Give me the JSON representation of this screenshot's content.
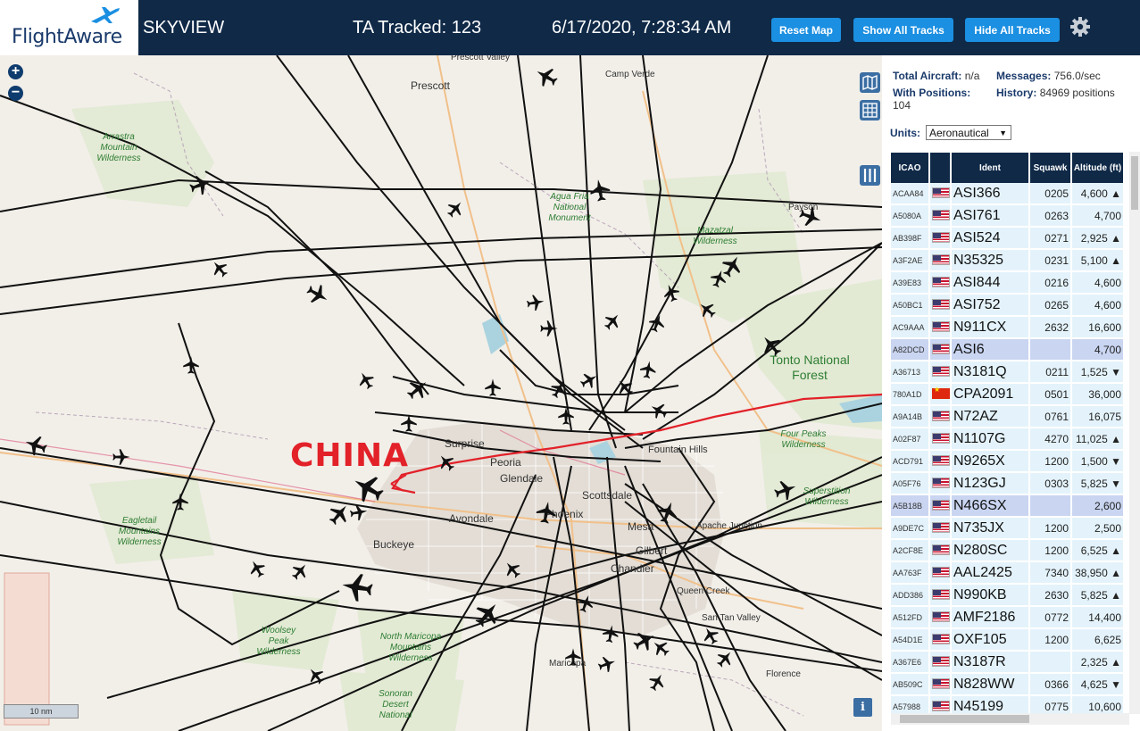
{
  "header": {
    "logo_text": "FlightAware",
    "app_title": "SKYVIEW",
    "tracked": "TA Tracked: 123",
    "datetime": "6/17/2020, 7:28:34 AM",
    "buttons": {
      "reset": "Reset Map",
      "show": "Show All Tracks",
      "hide": "Hide All Tracks"
    },
    "settings_icon": "gear-icon"
  },
  "map": {
    "zoom_in": "+",
    "zoom_out": "−",
    "scale": "10 nm",
    "info": "i",
    "annotation": "CHINA",
    "cities": [
      "Prescott Valley",
      "Prescott",
      "Camp Verde",
      "Payson",
      "Surprise",
      "Peoria",
      "Glendale",
      "Scottsdale",
      "Fountain Hills",
      "Phoenix",
      "Avondale",
      "Buckeye",
      "Mesa",
      "Apache Junction",
      "Gilbert",
      "Chandler",
      "Queen Creek",
      "San Tan Valley",
      "Maricopa",
      "Florence"
    ],
    "wilderness": [
      "Arrastra Mountain Wilderness",
      "Agua Fria National Monument",
      "Mazatzal Wilderness",
      "Four Peaks Wilderness",
      "Superstition Wilderness",
      "Eagletail Mountains Wilderness",
      "Woolsey Peak Wilderness",
      "North Maricopa Mountains Wilderness",
      "Sonoran Desert National"
    ],
    "forest": "Tonto National Forest"
  },
  "stats": {
    "total_label": "Total Aircraft:",
    "total_value": "n/a",
    "messages_label": "Messages:",
    "messages_value": "756.0/sec",
    "positions_label": "With Positions:",
    "positions_value": "104",
    "history_label": "History:",
    "history_value": "84969 positions"
  },
  "units": {
    "label": "Units:",
    "value": "Aeronautical"
  },
  "table": {
    "columns": [
      "ICAO",
      "",
      "Ident",
      "Squawk",
      "Altitude (ft)"
    ],
    "rows": [
      {
        "icao": "ACAA84",
        "flag": "us",
        "ident": "ASI366",
        "squawk": "0205",
        "alt": "4,600 ▲"
      },
      {
        "icao": "A5080A",
        "flag": "us",
        "ident": "ASI761",
        "squawk": "0263",
        "alt": "4,700"
      },
      {
        "icao": "AB398F",
        "flag": "us",
        "ident": "ASI524",
        "squawk": "0271",
        "alt": "2,925 ▲"
      },
      {
        "icao": "A3F2AE",
        "flag": "us",
        "ident": "N35325",
        "squawk": "0231",
        "alt": "5,100 ▲"
      },
      {
        "icao": "A39E83",
        "flag": "us",
        "ident": "ASI844",
        "squawk": "0216",
        "alt": "4,600"
      },
      {
        "icao": "A50BC1",
        "flag": "us",
        "ident": "ASI752",
        "squawk": "0265",
        "alt": "4,600"
      },
      {
        "icao": "AC9AAA",
        "flag": "us",
        "ident": "N911CX",
        "squawk": "2632",
        "alt": "16,600"
      },
      {
        "icao": "A82DCD",
        "flag": "us",
        "ident": "ASI6",
        "squawk": "",
        "alt": "4,700",
        "selected": true
      },
      {
        "icao": "A36713",
        "flag": "us",
        "ident": "N3181Q",
        "squawk": "0211",
        "alt": "1,525 ▼"
      },
      {
        "icao": "780A1D",
        "flag": "cn",
        "ident": "CPA2091",
        "squawk": "0501",
        "alt": "36,000"
      },
      {
        "icao": "A9A14B",
        "flag": "us",
        "ident": "N72AZ",
        "squawk": "0761",
        "alt": "16,075"
      },
      {
        "icao": "A02F87",
        "flag": "us",
        "ident": "N1107G",
        "squawk": "4270",
        "alt": "11,025 ▲"
      },
      {
        "icao": "ACD791",
        "flag": "us",
        "ident": "N9265X",
        "squawk": "1200",
        "alt": "1,500 ▼"
      },
      {
        "icao": "A05F76",
        "flag": "us",
        "ident": "N123GJ",
        "squawk": "0303",
        "alt": "5,825 ▼"
      },
      {
        "icao": "A5B18B",
        "flag": "us",
        "ident": "N466SX",
        "squawk": "",
        "alt": "2,600",
        "selected": true
      },
      {
        "icao": "A9DE7C",
        "flag": "us",
        "ident": "N735JX",
        "squawk": "1200",
        "alt": "2,500"
      },
      {
        "icao": "A2CF8E",
        "flag": "us",
        "ident": "N280SC",
        "squawk": "1200",
        "alt": "6,525 ▲"
      },
      {
        "icao": "AA763F",
        "flag": "us",
        "ident": "AAL2425",
        "squawk": "7340",
        "alt": "38,950 ▲"
      },
      {
        "icao": "ADD386",
        "flag": "us",
        "ident": "N990KB",
        "squawk": "2630",
        "alt": "5,825 ▲"
      },
      {
        "icao": "A512FD",
        "flag": "us",
        "ident": "AMF2186",
        "squawk": "0772",
        "alt": "14,400"
      },
      {
        "icao": "A54D1E",
        "flag": "us",
        "ident": "OXF105",
        "squawk": "1200",
        "alt": "6,625"
      },
      {
        "icao": "A367E6",
        "flag": "us",
        "ident": "N3187R",
        "squawk": "",
        "alt": "2,325 ▲"
      },
      {
        "icao": "AB509C",
        "flag": "us",
        "ident": "N828WW",
        "squawk": "0366",
        "alt": "4,625 ▼"
      },
      {
        "icao": "A57988",
        "flag": "us",
        "ident": "N45199",
        "squawk": "0775",
        "alt": "10,600"
      }
    ]
  },
  "colors": {
    "header_bg": "#0f2947",
    "button": "#1b8fe1",
    "row_bg": "#e4f3fb",
    "row_selected": "#c9d5f1",
    "track": "#111111",
    "highlight_track": "#e22129"
  }
}
